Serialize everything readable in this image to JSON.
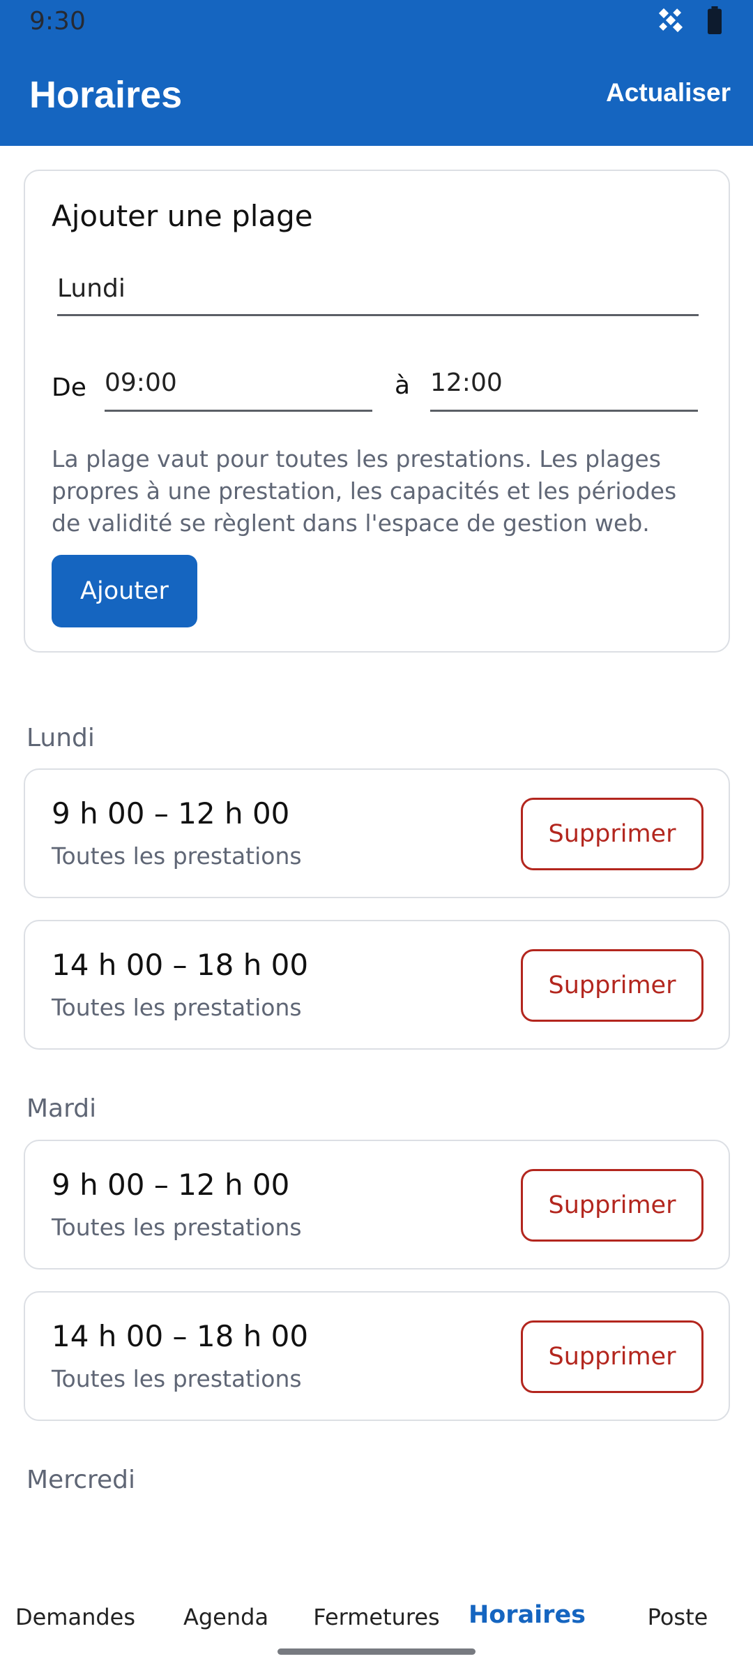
{
  "status_bar": {
    "time": "9:30"
  },
  "app_bar": {
    "title": "Horaires",
    "refresh_label": "Actualiser"
  },
  "add_slot": {
    "title": "Ajouter une plage",
    "day_value": "Lundi",
    "from_label": "De",
    "from_value": "09:00",
    "to_label": "à",
    "to_value": "12:00",
    "help_text": "La plage vaut pour toutes les prestations. Les plages propres à une prestation, les capacités et les périodes de validité se règlent dans l'espace de gestion web.",
    "add_button": "Ajouter"
  },
  "days": [
    {
      "name": "Lundi",
      "slots": [
        {
          "time": "9 h 00 – 12 h 00",
          "scope": "Toutes les prestations",
          "delete_label": "Supprimer"
        },
        {
          "time": "14 h 00 – 18 h 00",
          "scope": "Toutes les prestations",
          "delete_label": "Supprimer"
        }
      ]
    },
    {
      "name": "Mardi",
      "slots": [
        {
          "time": "9 h 00 – 12 h 00",
          "scope": "Toutes les prestations",
          "delete_label": "Supprimer"
        },
        {
          "time": "14 h 00 – 18 h 00",
          "scope": "Toutes les prestations",
          "delete_label": "Supprimer"
        }
      ]
    },
    {
      "name": "Mercredi",
      "slots": []
    }
  ],
  "bottom_nav": {
    "items": [
      {
        "label": "Demandes"
      },
      {
        "label": "Agenda"
      },
      {
        "label": "Fermetures"
      },
      {
        "label": "Horaires"
      },
      {
        "label": "Poste"
      }
    ],
    "active": "Horaires"
  },
  "colors": {
    "primary": "#1565c0",
    "danger": "#b3261e",
    "secondary_text": "#5f6675"
  },
  "icons": [
    "satellite-icon",
    "battery-icon"
  ]
}
